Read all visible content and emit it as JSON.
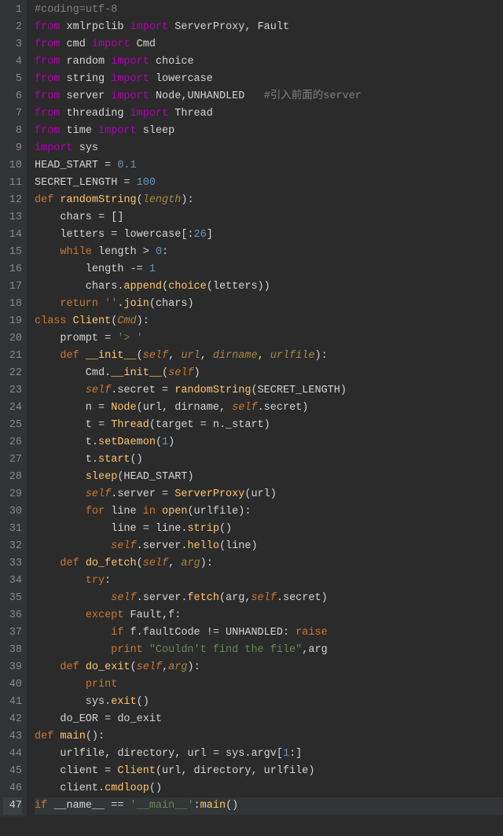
{
  "lines": [
    {
      "n": 1,
      "tokens": [
        {
          "t": "#coding=utf-8",
          "c": "cmt"
        }
      ]
    },
    {
      "n": 2,
      "tokens": [
        {
          "t": "from ",
          "c": "imp"
        },
        {
          "t": "xmlrpclib ",
          "c": "mod"
        },
        {
          "t": "import ",
          "c": "imp"
        },
        {
          "t": "ServerProxy, Fault",
          "c": "id"
        }
      ]
    },
    {
      "n": 3,
      "tokens": [
        {
          "t": "from ",
          "c": "imp"
        },
        {
          "t": "cmd ",
          "c": "mod"
        },
        {
          "t": "import ",
          "c": "imp"
        },
        {
          "t": "Cmd",
          "c": "id"
        }
      ]
    },
    {
      "n": 4,
      "tokens": [
        {
          "t": "from ",
          "c": "imp"
        },
        {
          "t": "random ",
          "c": "mod"
        },
        {
          "t": "import ",
          "c": "imp"
        },
        {
          "t": "choice",
          "c": "id"
        }
      ]
    },
    {
      "n": 5,
      "tokens": [
        {
          "t": "from ",
          "c": "imp"
        },
        {
          "t": "string ",
          "c": "mod"
        },
        {
          "t": "import ",
          "c": "imp"
        },
        {
          "t": "lowercase",
          "c": "id"
        }
      ]
    },
    {
      "n": 6,
      "tokens": [
        {
          "t": "from ",
          "c": "imp"
        },
        {
          "t": "server ",
          "c": "mod"
        },
        {
          "t": "import ",
          "c": "imp"
        },
        {
          "t": "Node,UNHANDLED   ",
          "c": "id"
        },
        {
          "t": "#引入前面的server",
          "c": "cmt"
        }
      ]
    },
    {
      "n": 7,
      "tokens": [
        {
          "t": "from ",
          "c": "imp"
        },
        {
          "t": "threading ",
          "c": "mod"
        },
        {
          "t": "import ",
          "c": "imp"
        },
        {
          "t": "Thread",
          "c": "id"
        }
      ]
    },
    {
      "n": 8,
      "tokens": [
        {
          "t": "from ",
          "c": "imp"
        },
        {
          "t": "time ",
          "c": "mod"
        },
        {
          "t": "import ",
          "c": "imp"
        },
        {
          "t": "sleep",
          "c": "id"
        }
      ]
    },
    {
      "n": 9,
      "tokens": [
        {
          "t": "import ",
          "c": "imp"
        },
        {
          "t": "sys",
          "c": "mod"
        }
      ]
    },
    {
      "n": 10,
      "tokens": [
        {
          "t": "HEAD_START = ",
          "c": "id"
        },
        {
          "t": "0.1",
          "c": "num"
        }
      ]
    },
    {
      "n": 11,
      "tokens": [
        {
          "t": "SECRET_LENGTH = ",
          "c": "id"
        },
        {
          "t": "100",
          "c": "num"
        }
      ]
    },
    {
      "n": 12,
      "tokens": [
        {
          "t": "def ",
          "c": "def"
        },
        {
          "t": "randomString",
          "c": "name"
        },
        {
          "t": "(",
          "c": "punct"
        },
        {
          "t": "length",
          "c": "param"
        },
        {
          "t": "):",
          "c": "punct"
        }
      ]
    },
    {
      "n": 13,
      "tokens": [
        {
          "t": "    chars = []",
          "c": "id"
        }
      ]
    },
    {
      "n": 14,
      "tokens": [
        {
          "t": "    letters = lowercase[:",
          "c": "id"
        },
        {
          "t": "26",
          "c": "num"
        },
        {
          "t": "]",
          "c": "id"
        }
      ]
    },
    {
      "n": 15,
      "tokens": [
        {
          "t": "    ",
          "c": "id"
        },
        {
          "t": "while ",
          "c": "kw"
        },
        {
          "t": "length > ",
          "c": "id"
        },
        {
          "t": "0",
          "c": "num"
        },
        {
          "t": ":",
          "c": "id"
        }
      ]
    },
    {
      "n": 16,
      "tokens": [
        {
          "t": "        length -= ",
          "c": "id"
        },
        {
          "t": "1",
          "c": "num"
        }
      ]
    },
    {
      "n": 17,
      "tokens": [
        {
          "t": "        chars.",
          "c": "id"
        },
        {
          "t": "append",
          "c": "name"
        },
        {
          "t": "(",
          "c": "id"
        },
        {
          "t": "choice",
          "c": "name"
        },
        {
          "t": "(letters))",
          "c": "id"
        }
      ]
    },
    {
      "n": 18,
      "tokens": [
        {
          "t": "    ",
          "c": "id"
        },
        {
          "t": "return ",
          "c": "kw"
        },
        {
          "t": "''",
          "c": "str"
        },
        {
          "t": ".",
          "c": "id"
        },
        {
          "t": "join",
          "c": "name"
        },
        {
          "t": "(chars)",
          "c": "id"
        }
      ]
    },
    {
      "n": 19,
      "tokens": [
        {
          "t": "class ",
          "c": "def"
        },
        {
          "t": "Client",
          "c": "name"
        },
        {
          "t": "(",
          "c": "id"
        },
        {
          "t": "Cmd",
          "c": "param"
        },
        {
          "t": "):",
          "c": "id"
        }
      ]
    },
    {
      "n": 20,
      "tokens": [
        {
          "t": "    prompt = ",
          "c": "id"
        },
        {
          "t": "'> '",
          "c": "str"
        }
      ]
    },
    {
      "n": 21,
      "tokens": [
        {
          "t": "    ",
          "c": "id"
        },
        {
          "t": "def ",
          "c": "def"
        },
        {
          "t": "__init__",
          "c": "name"
        },
        {
          "t": "(",
          "c": "id"
        },
        {
          "t": "self",
          "c": "self"
        },
        {
          "t": ", ",
          "c": "id"
        },
        {
          "t": "url",
          "c": "param"
        },
        {
          "t": ", ",
          "c": "id"
        },
        {
          "t": "dirname",
          "c": "param"
        },
        {
          "t": ", ",
          "c": "id"
        },
        {
          "t": "urlfile",
          "c": "param"
        },
        {
          "t": "):",
          "c": "id"
        }
      ]
    },
    {
      "n": 22,
      "tokens": [
        {
          "t": "        Cmd.",
          "c": "id"
        },
        {
          "t": "__init__",
          "c": "name"
        },
        {
          "t": "(",
          "c": "id"
        },
        {
          "t": "self",
          "c": "self"
        },
        {
          "t": ")",
          "c": "id"
        }
      ]
    },
    {
      "n": 23,
      "tokens": [
        {
          "t": "        ",
          "c": "id"
        },
        {
          "t": "self",
          "c": "self"
        },
        {
          "t": ".secret = ",
          "c": "id"
        },
        {
          "t": "randomString",
          "c": "name"
        },
        {
          "t": "(SECRET_LENGTH)",
          "c": "id"
        }
      ]
    },
    {
      "n": 24,
      "tokens": [
        {
          "t": "        n = ",
          "c": "id"
        },
        {
          "t": "Node",
          "c": "name"
        },
        {
          "t": "(url, dirname, ",
          "c": "id"
        },
        {
          "t": "self",
          "c": "self"
        },
        {
          "t": ".secret)",
          "c": "id"
        }
      ]
    },
    {
      "n": 25,
      "tokens": [
        {
          "t": "        t = ",
          "c": "id"
        },
        {
          "t": "Thread",
          "c": "name"
        },
        {
          "t": "(target = n._start)",
          "c": "id"
        }
      ]
    },
    {
      "n": 26,
      "tokens": [
        {
          "t": "        t.",
          "c": "id"
        },
        {
          "t": "setDaemon",
          "c": "name"
        },
        {
          "t": "(",
          "c": "id"
        },
        {
          "t": "1",
          "c": "num"
        },
        {
          "t": ")",
          "c": "id"
        }
      ]
    },
    {
      "n": 27,
      "tokens": [
        {
          "t": "        t.",
          "c": "id"
        },
        {
          "t": "start",
          "c": "name"
        },
        {
          "t": "()",
          "c": "id"
        }
      ]
    },
    {
      "n": 28,
      "tokens": [
        {
          "t": "        ",
          "c": "id"
        },
        {
          "t": "sleep",
          "c": "name"
        },
        {
          "t": "(HEAD_START)",
          "c": "id"
        }
      ]
    },
    {
      "n": 29,
      "tokens": [
        {
          "t": "        ",
          "c": "id"
        },
        {
          "t": "self",
          "c": "self"
        },
        {
          "t": ".server = ",
          "c": "id"
        },
        {
          "t": "ServerProxy",
          "c": "name"
        },
        {
          "t": "(url)",
          "c": "id"
        }
      ]
    },
    {
      "n": 30,
      "tokens": [
        {
          "t": "        ",
          "c": "id"
        },
        {
          "t": "for ",
          "c": "kw"
        },
        {
          "t": "line ",
          "c": "id"
        },
        {
          "t": "in ",
          "c": "kw"
        },
        {
          "t": "open",
          "c": "name"
        },
        {
          "t": "(urlfile):",
          "c": "id"
        }
      ]
    },
    {
      "n": 31,
      "tokens": [
        {
          "t": "            line = line.",
          "c": "id"
        },
        {
          "t": "strip",
          "c": "name"
        },
        {
          "t": "()",
          "c": "id"
        }
      ]
    },
    {
      "n": 32,
      "tokens": [
        {
          "t": "            ",
          "c": "id"
        },
        {
          "t": "self",
          "c": "self"
        },
        {
          "t": ".server.",
          "c": "id"
        },
        {
          "t": "hello",
          "c": "name"
        },
        {
          "t": "(line)",
          "c": "id"
        }
      ]
    },
    {
      "n": 33,
      "tokens": [
        {
          "t": "    ",
          "c": "id"
        },
        {
          "t": "def ",
          "c": "def"
        },
        {
          "t": "do_fetch",
          "c": "name"
        },
        {
          "t": "(",
          "c": "id"
        },
        {
          "t": "self",
          "c": "self"
        },
        {
          "t": ", ",
          "c": "id"
        },
        {
          "t": "arg",
          "c": "param"
        },
        {
          "t": "):",
          "c": "id"
        }
      ]
    },
    {
      "n": 34,
      "tokens": [
        {
          "t": "        ",
          "c": "id"
        },
        {
          "t": "try",
          "c": "kw"
        },
        {
          "t": ":",
          "c": "id"
        }
      ]
    },
    {
      "n": 35,
      "tokens": [
        {
          "t": "            ",
          "c": "id"
        },
        {
          "t": "self",
          "c": "self"
        },
        {
          "t": ".server.",
          "c": "id"
        },
        {
          "t": "fetch",
          "c": "name"
        },
        {
          "t": "(arg,",
          "c": "id"
        },
        {
          "t": "self",
          "c": "self"
        },
        {
          "t": ".secret)",
          "c": "id"
        }
      ]
    },
    {
      "n": 36,
      "tokens": [
        {
          "t": "        ",
          "c": "id"
        },
        {
          "t": "except ",
          "c": "kw"
        },
        {
          "t": "Fault,f:",
          "c": "id"
        }
      ]
    },
    {
      "n": 37,
      "tokens": [
        {
          "t": "            ",
          "c": "id"
        },
        {
          "t": "if ",
          "c": "kw"
        },
        {
          "t": "f.faultCode != UNHANDLED: ",
          "c": "id"
        },
        {
          "t": "raise",
          "c": "kw"
        }
      ]
    },
    {
      "n": 38,
      "tokens": [
        {
          "t": "            ",
          "c": "id"
        },
        {
          "t": "print ",
          "c": "kw"
        },
        {
          "t": "\"Couldn't find the file\"",
          "c": "str"
        },
        {
          "t": ",arg",
          "c": "id"
        }
      ]
    },
    {
      "n": 39,
      "tokens": [
        {
          "t": "    ",
          "c": "id"
        },
        {
          "t": "def ",
          "c": "def"
        },
        {
          "t": "do_exit",
          "c": "name"
        },
        {
          "t": "(",
          "c": "id"
        },
        {
          "t": "self",
          "c": "self"
        },
        {
          "t": ",",
          "c": "id"
        },
        {
          "t": "arg",
          "c": "param"
        },
        {
          "t": "):",
          "c": "id"
        }
      ]
    },
    {
      "n": 40,
      "tokens": [
        {
          "t": "        ",
          "c": "id"
        },
        {
          "t": "print",
          "c": "kw"
        }
      ]
    },
    {
      "n": 41,
      "tokens": [
        {
          "t": "        sys.",
          "c": "id"
        },
        {
          "t": "exit",
          "c": "name"
        },
        {
          "t": "()",
          "c": "id"
        }
      ]
    },
    {
      "n": 42,
      "tokens": [
        {
          "t": "    do_EOR = do_exit",
          "c": "id"
        }
      ]
    },
    {
      "n": 43,
      "tokens": [
        {
          "t": "def ",
          "c": "def"
        },
        {
          "t": "main",
          "c": "name"
        },
        {
          "t": "():",
          "c": "id"
        }
      ]
    },
    {
      "n": 44,
      "tokens": [
        {
          "t": "    urlfile, directory, url = sys.argv[",
          "c": "id"
        },
        {
          "t": "1",
          "c": "num"
        },
        {
          "t": ":]",
          "c": "id"
        }
      ]
    },
    {
      "n": 45,
      "tokens": [
        {
          "t": "    client = ",
          "c": "id"
        },
        {
          "t": "Client",
          "c": "name"
        },
        {
          "t": "(url, directory, urlfile)",
          "c": "id"
        }
      ]
    },
    {
      "n": 46,
      "tokens": [
        {
          "t": "    client.",
          "c": "id"
        },
        {
          "t": "cmdloop",
          "c": "name"
        },
        {
          "t": "()",
          "c": "id"
        }
      ]
    },
    {
      "n": 47,
      "cur": true,
      "tokens": [
        {
          "t": "if ",
          "c": "kw"
        },
        {
          "t": "__name__ == ",
          "c": "id"
        },
        {
          "t": "'__main__'",
          "c": "str"
        },
        {
          "t": ":",
          "c": "id"
        },
        {
          "t": "main",
          "c": "name"
        },
        {
          "t": "()",
          "c": "id"
        }
      ]
    }
  ]
}
